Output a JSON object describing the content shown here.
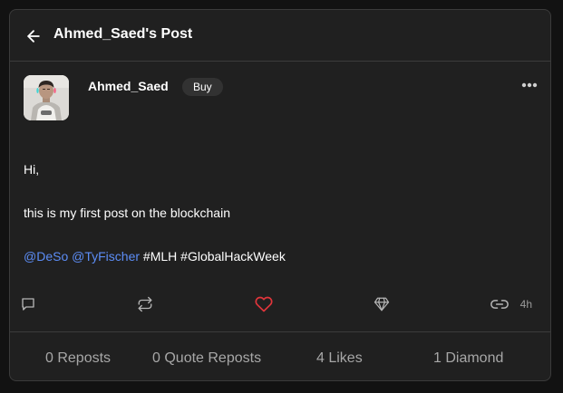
{
  "header": {
    "title": "Ahmed_Saed's Post",
    "back_icon": "arrow-left-icon"
  },
  "post": {
    "author": "Ahmed_Saed",
    "buy_label": "Buy",
    "more_icon": "more-horizontal-icon",
    "body": {
      "greeting": "Hi,",
      "line": "this is my first post on the blockchain",
      "mentions": [
        "@DeSo",
        "@TyFischer"
      ],
      "hashtags": [
        "#MLH",
        "#GlobalHackWeek"
      ]
    },
    "actions": {
      "comment_icon": "comment-icon",
      "repost_icon": "repost-icon",
      "like_icon": "heart-icon",
      "diamond_icon": "diamond-icon",
      "link_icon": "link-icon",
      "time": "4h"
    },
    "stats": {
      "reposts": "0 Reposts",
      "quote_reposts": "0 Quote Reposts",
      "likes": "4 Likes",
      "diamonds": "1 Diamond"
    }
  },
  "colors": {
    "background": "#202020",
    "mention": "#5c8df6",
    "like": "#e0353b",
    "muted": "#a7a7a7"
  }
}
